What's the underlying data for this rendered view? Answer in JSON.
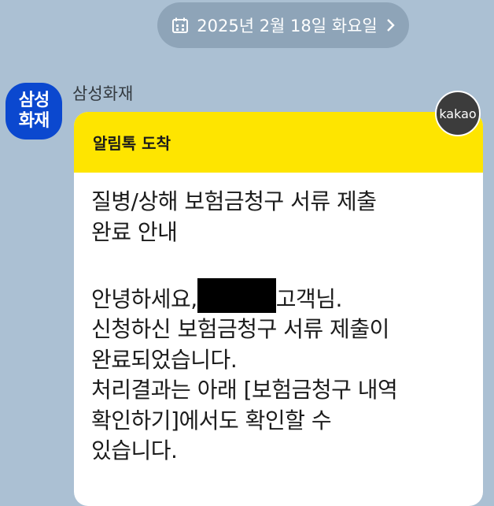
{
  "date_bar": {
    "text": "2025년 2월 18일 화요일",
    "icon": "calendar-icon",
    "chevron": "chevron-right-icon"
  },
  "sender": {
    "avatar_line1": "삼성",
    "avatar_line2": "화재",
    "name": "삼성화재",
    "avatar_color": "#0b48cf"
  },
  "badge": {
    "label": "kakao"
  },
  "message": {
    "header": "알림톡 도착",
    "header_color": "#fee500",
    "title_line1": "질병/상해 보험금청구 서류 제출",
    "title_line2": "완료 안내",
    "greeting_prefix": "안녕하세요,",
    "greeting_suffix": "고객님.",
    "body_line1": "신청하신 보험금청구 서류 제출이",
    "body_line2": "완료되었습니다.",
    "body_line3": "처리결과는 아래 [보험금청구 내역",
    "body_line4": "확인하기]에서도 확인할 수",
    "body_line5": "있습니다."
  }
}
